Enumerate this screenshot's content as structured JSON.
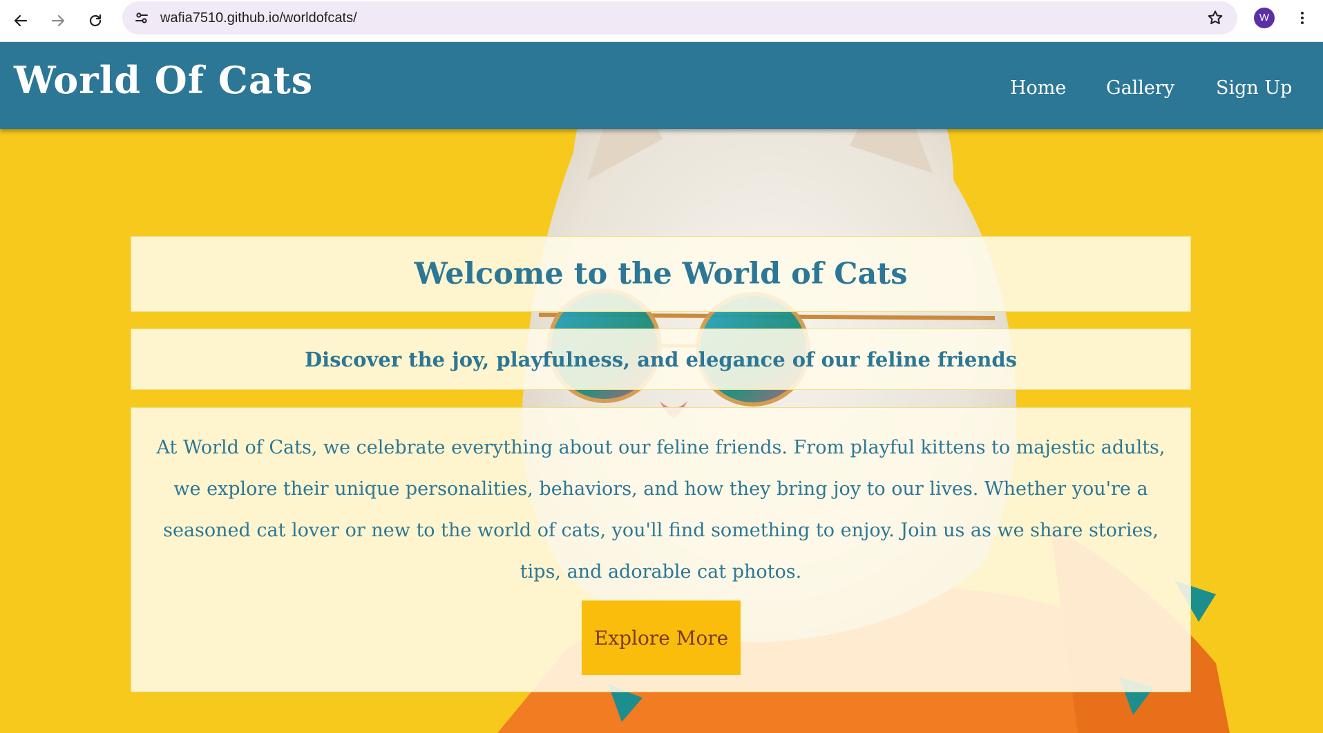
{
  "browser": {
    "url": "wafia7510.github.io/worldofcats/",
    "profile_initial": "W",
    "icons": {
      "back": "back-arrow-icon",
      "forward": "forward-arrow-icon",
      "reload": "reload-icon",
      "site_info": "site-settings-icon",
      "bookmark": "star-icon",
      "menu": "kebab-menu-icon"
    }
  },
  "site": {
    "title": "World Of Cats",
    "nav": [
      "Home",
      "Gallery",
      "Sign Up"
    ]
  },
  "hero": {
    "heading": "Welcome to the World of Cats",
    "subheading": "Discover the joy, playfulness, and elegance of our feline friends",
    "body": "At World of Cats, we celebrate everything about our feline friends. From playful kittens to majestic adults, we explore their unique personalities, behaviors, and how they bring joy to our lives. Whether you're a seasoned cat lover or new to the world of cats, you'll find something to enjoy. Join us as we share stories, tips, and adorable cat photos.",
    "button_label": "Explore More"
  },
  "colors": {
    "header_bg": "#2c7795",
    "page_bg": "#f7c91c",
    "accent_text": "#2c7795",
    "button_bg": "#fbbd0c",
    "button_text": "#7a3b1f",
    "panel_bg": "#fffbe8"
  }
}
